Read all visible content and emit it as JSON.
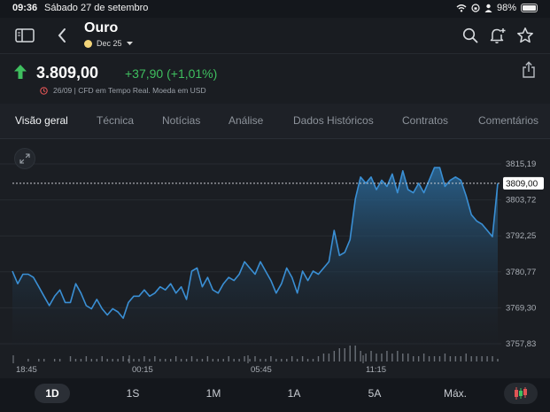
{
  "status": {
    "time": "09:36",
    "date": "Sábado 27 de setembro",
    "battery": "98%"
  },
  "header": {
    "title": "Ouro",
    "contract": "Dec 25"
  },
  "quote": {
    "price": "3.809,00",
    "change": "+37,90 (+1,01%)",
    "info": "26/09 | CFD em Tempo Real. Moeda em USD",
    "direction": "up",
    "color_up": "#3fbf5f"
  },
  "tabs": [
    "Visão geral",
    "Técnica",
    "Notícias",
    "Análise",
    "Dados Históricos",
    "Contratos",
    "Comentários"
  ],
  "periods": [
    "1D",
    "1S",
    "1M",
    "1A",
    "5A",
    "Máx."
  ],
  "icons": {
    "sidebar": "sidebar-icon",
    "back": "chevron-left-icon",
    "search": "search-icon",
    "alert": "bell-plus-icon",
    "watchlist": "star-icon",
    "share": "share-icon",
    "expand": "expand-icon",
    "candles": "candlestick-icon"
  },
  "chart_data": {
    "type": "area",
    "color": "#3a8fd4",
    "x_ticks": [
      "18:45",
      "00:15",
      "05:45",
      "11:15"
    ],
    "y_ticks": [
      "3815,19",
      "3803,72",
      "3792,25",
      "3780,77",
      "3769,30",
      "3757,83"
    ],
    "ylim": [
      3757.83,
      3815.19
    ],
    "current_price": 3809.0,
    "current_label": "3809,00",
    "values": [
      3781.0,
      3777.0,
      3780.0,
      3780.0,
      3779.0,
      3776.0,
      3773.0,
      3770.0,
      3773.0,
      3775.0,
      3771.0,
      3771.0,
      3777.0,
      3774.0,
      3770.0,
      3769.0,
      3772.0,
      3769.0,
      3767.0,
      3769.0,
      3768.0,
      3766.0,
      3771.0,
      3773.0,
      3773.0,
      3775.0,
      3773.0,
      3774.0,
      3776.0,
      3775.0,
      3777.0,
      3774.0,
      3776.0,
      3772.0,
      3781.0,
      3782.0,
      3776.0,
      3779.0,
      3775.0,
      3774.0,
      3777.0,
      3779.0,
      3778.0,
      3780.0,
      3784.0,
      3782.0,
      3780.0,
      3784.0,
      3781.0,
      3778.0,
      3774.0,
      3777.0,
      3782.0,
      3779.0,
      3774.0,
      3781.0,
      3778.0,
      3781.0,
      3780.0,
      3782.0,
      3784.0,
      3794.0,
      3786.0,
      3787.0,
      3791.0,
      3804.0,
      3811.0,
      3809.0,
      3811.0,
      3807.0,
      3810.0,
      3808.0,
      3812.0,
      3806.0,
      3813.0,
      3807.0,
      3806.0,
      3809.0,
      3806.0,
      3810.0,
      3814.0,
      3814.0,
      3808.0,
      3810.0,
      3811.0,
      3810.0,
      3805.0,
      3799.0,
      3797.0,
      3796.0,
      3794.0,
      3792.0,
      3809.0
    ],
    "volume": [
      0,
      0,
      0,
      1,
      0,
      1,
      1,
      0,
      1,
      1,
      0,
      2,
      1,
      1,
      2,
      1,
      1,
      2,
      1,
      1,
      1,
      2,
      1,
      1,
      1,
      2,
      1,
      2,
      1,
      1,
      1,
      2,
      1,
      1,
      2,
      1,
      1,
      2,
      1,
      1,
      1,
      2,
      1,
      1,
      2,
      1,
      2,
      1,
      1,
      2,
      1,
      1,
      1,
      2,
      1,
      2,
      1,
      1,
      2,
      3,
      3,
      4,
      5,
      5,
      6,
      6,
      4,
      3,
      4,
      3,
      3,
      4,
      3,
      4,
      3,
      3,
      2,
      2,
      3,
      2,
      2,
      2,
      3,
      2,
      2,
      2,
      3,
      2,
      2,
      2,
      2,
      2,
      1
    ]
  }
}
